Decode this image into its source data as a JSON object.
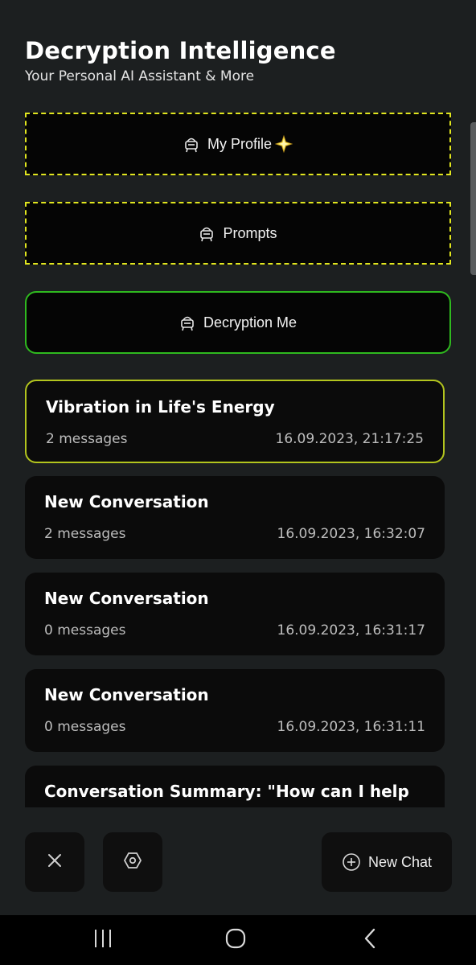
{
  "header": {
    "title": "Decryption Intelligence",
    "subtitle": "Your Personal AI Assistant & More"
  },
  "nav_buttons": [
    {
      "label": "My Profile",
      "icon": "robot-icon",
      "emoji": "sparkle-star-icon",
      "style": "dashed"
    },
    {
      "label": "Prompts",
      "icon": "robot-icon",
      "style": "dashed"
    },
    {
      "label": "Decryption Me",
      "icon": "robot-icon",
      "style": "solid"
    }
  ],
  "conversations": [
    {
      "title": "Vibration in Life's Energy",
      "count": "2 messages",
      "date": "16.09.2023, 21:17:25",
      "active": true
    },
    {
      "title": "New Conversation",
      "count": "2 messages",
      "date": "16.09.2023, 16:32:07"
    },
    {
      "title": "New Conversation",
      "count": "0 messages",
      "date": "16.09.2023, 16:31:17"
    },
    {
      "title": "New Conversation",
      "count": "0 messages",
      "date": "16.09.2023, 16:31:11"
    },
    {
      "title": "Conversation Summary: \"How can I help"
    }
  ],
  "bottom_bar": {
    "close_icon": "close-icon",
    "settings_icon": "hexagon-settings-icon",
    "new_chat_label": "New Chat",
    "new_chat_icon": "plus-circle-icon"
  },
  "system_nav": {
    "recents_icon": "recents-icon",
    "home_icon": "home-icon",
    "back_icon": "back-icon"
  },
  "colors": {
    "background": "#1c1f20",
    "dashed_accent": "#e1e61f",
    "solid_accent": "#2fba1f",
    "active_conversation_border": "#b3c51e",
    "card": "#0b0b0b"
  }
}
